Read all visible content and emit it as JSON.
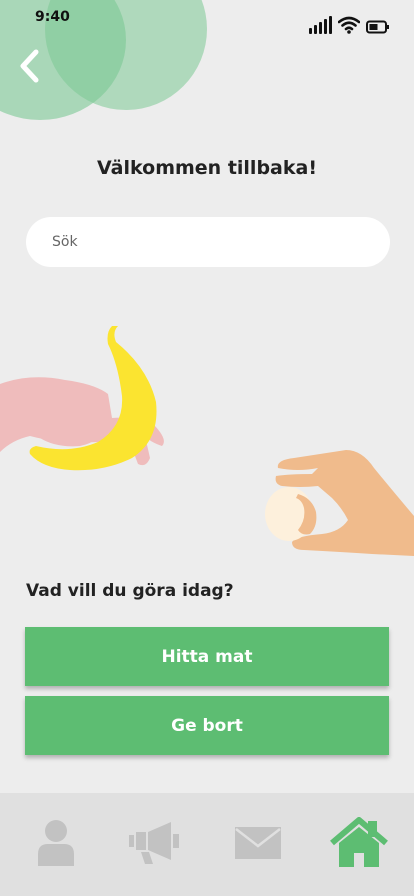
{
  "status_bar": {
    "time": "9:40"
  },
  "header": {
    "title": "Välkommen tillbaka!",
    "back_icon": "chevron-left-icon"
  },
  "search": {
    "placeholder": "Sök",
    "value": ""
  },
  "question": "Vad vill du göra idag?",
  "actions": [
    {
      "label": "Hitta mat"
    },
    {
      "label": "Ge bort"
    }
  ],
  "tab_bar": {
    "items": [
      {
        "icon": "profile-icon",
        "active": false
      },
      {
        "icon": "megaphone-icon",
        "active": false
      },
      {
        "icon": "mail-icon",
        "active": false
      },
      {
        "icon": "home-icon",
        "active": true
      }
    ]
  },
  "colors": {
    "background": "#ededed",
    "accent": "#5dbd72",
    "blob": "#7cc894",
    "tab_inactive": "#c2c2c2",
    "tab_bar": "#e0e0e0"
  }
}
